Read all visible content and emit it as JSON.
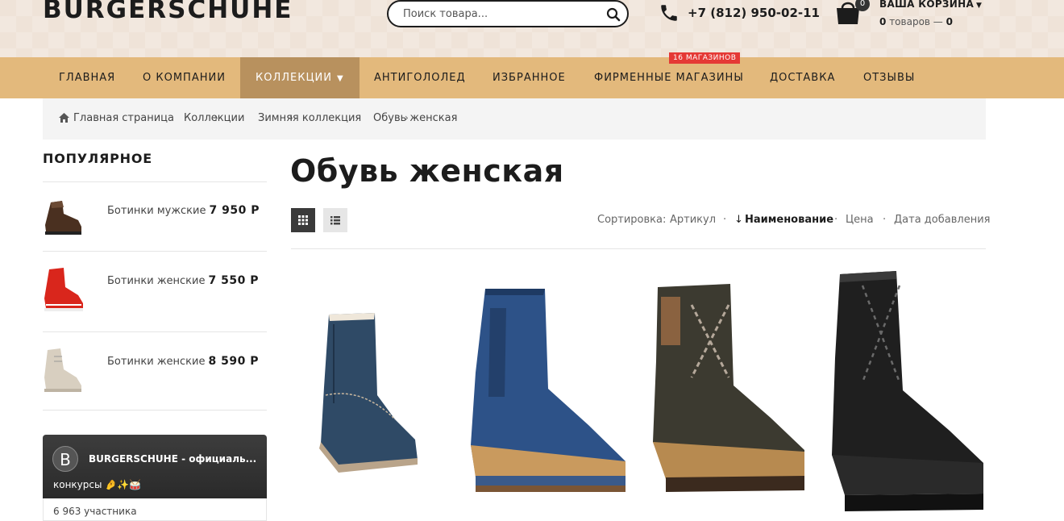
{
  "header": {
    "logo": "BURGERSCHUHE",
    "search_placeholder": "Поиск товара...",
    "phone": "+7 (812) 950-02-11",
    "cart": {
      "count_badge": "0",
      "title": "ВАША КОРЗИНА",
      "items_count": "0",
      "items_word": "товаров —",
      "total": "0"
    }
  },
  "nav": {
    "items": [
      {
        "label": "ГЛАВНАЯ"
      },
      {
        "label": "О КОМПАНИИ"
      },
      {
        "label": "КОЛЛЕКЦИИ",
        "active": true
      },
      {
        "label": "АНТИГОЛОЛЕД"
      },
      {
        "label": "ИЗБРАННОЕ"
      },
      {
        "label": "ФИРМЕННЫЕ МАГАЗИНЫ"
      },
      {
        "label": "ДОСТАВКА"
      },
      {
        "label": "ОТЗЫВЫ"
      }
    ],
    "stores_badge": "16 МАГАЗИНОВ"
  },
  "breadcrumb": [
    "Главная страница",
    "Коллекции",
    "Зимняя коллекция",
    "Обувь женская"
  ],
  "sidebar": {
    "title": "ПОПУЛЯРНОЕ",
    "popular": [
      {
        "name": "Ботинки мужские",
        "price": "7 950 Р",
        "color": "#5a3b2a"
      },
      {
        "name": "Ботинки женские",
        "price": "7 550 Р",
        "color": "#d9261c"
      },
      {
        "name": "Ботинки женские",
        "price": "8 590 Р",
        "color": "#d8cfc0"
      }
    ],
    "vk": {
      "avatar_letter": "B",
      "name": "BURGERSCHUHE - официаль...",
      "status": "конкурсы 🤌✨🥁",
      "members": "6 963 участника"
    }
  },
  "main": {
    "title": "Обувь женская",
    "sort": {
      "label": "Сортировка:",
      "options": [
        "Артикул",
        "Наименование",
        "Цена",
        "Дата добавления"
      ],
      "active": "Наименование"
    }
  },
  "colors": {
    "nav_bg": "#e3b97c",
    "nav_active": "#b8915e",
    "badge_red": "#e53935"
  },
  "icons": [
    "search-icon",
    "phone-icon",
    "cart-icon",
    "home-icon",
    "grid-view-icon",
    "list-view-icon"
  ]
}
